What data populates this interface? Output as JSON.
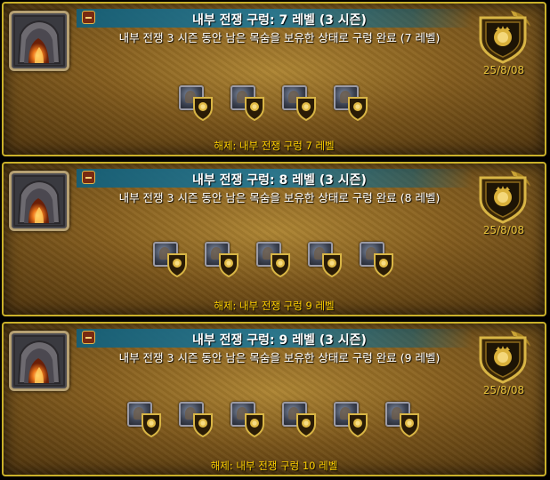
{
  "achievements": [
    {
      "title": "내부 전쟁 구렁: 7 레벨 (3 시즌)",
      "description": "내부 전쟁 3 시즌 동안 남은 목숨을 보유한 상태로 구렁 완료 (7 레벨)",
      "date": "25/8/08",
      "reward_count": 4,
      "unlock": "해제: 내부 전쟁 구렁 7 레벨",
      "icon": "delve-cave-icon",
      "badge_icon": "lion-shield-icon"
    },
    {
      "title": "내부 전쟁 구렁: 8 레벨 (3 시즌)",
      "description": "내부 전쟁 3 시즌 동안 남은 목숨을 보유한 상태로 구렁 완료 (8 레벨)",
      "date": "25/8/08",
      "reward_count": 5,
      "unlock": "해제: 내부 전쟁 구렁 9 레벨",
      "icon": "delve-cave-icon",
      "badge_icon": "lion-shield-icon"
    },
    {
      "title": "내부 전쟁 구렁: 9 레벨 (3 시즌)",
      "description": "내부 전쟁 3 시즌 동안 남은 목숨을 보유한 상태로 구렁 완료 (9 레벨)",
      "date": "25/8/08",
      "reward_count": 6,
      "unlock": "해제: 내부 전쟁 구렁 10 레벨",
      "icon": "delve-cave-icon",
      "badge_icon": "lion-shield-icon"
    }
  ],
  "colors": {
    "border": "#c9b02a",
    "title_bar": "#1f6f8c",
    "unlock_text": "#ffd100",
    "date_text": "#e7c23a"
  }
}
